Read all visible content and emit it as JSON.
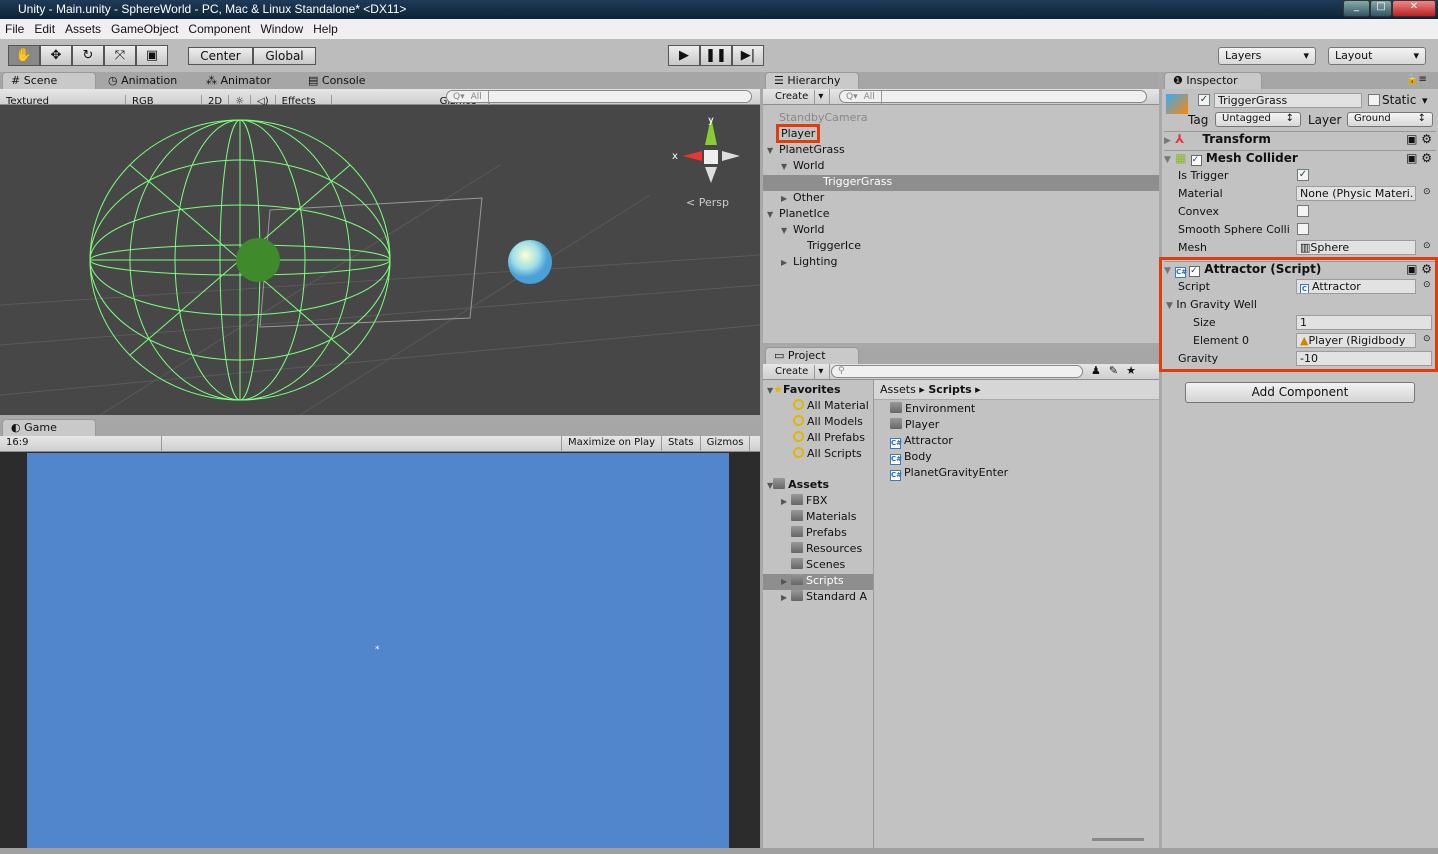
{
  "window": {
    "title": "Unity - Main.unity - SphereWorld - PC, Mac & Linux Standalone* <DX11>"
  },
  "menu": [
    "File",
    "Edit",
    "Assets",
    "GameObject",
    "Component",
    "Window",
    "Help"
  ],
  "toolbar": {
    "pivot": "Center",
    "space": "Global",
    "layers": "Layers",
    "layout": "Layout"
  },
  "scene": {
    "tabs": [
      "Scene",
      "Animation",
      "Animator",
      "Console"
    ],
    "shading": "Textured",
    "channel": "RGB",
    "mode2d": "2D",
    "effects": "Effects",
    "gizmos": "Gizmos",
    "search_placeholder": "All",
    "persp": "Persp",
    "axis_x": "x",
    "axis_y": "y"
  },
  "game": {
    "tab": "Game",
    "aspect": "16:9",
    "maximize": "Maximize on Play",
    "stats": "Stats",
    "gizmos": "Gizmos",
    "bg_color": "#5185cc"
  },
  "hierarchy": {
    "tab": "Hierarchy",
    "create": "Create",
    "search_placeholder": "All",
    "items": [
      {
        "label": "StandbyCamera",
        "indent": 0,
        "arrow": ""
      },
      {
        "label": "Player",
        "indent": 0,
        "arrow": "",
        "highlighted": true
      },
      {
        "label": "PlanetGrass",
        "indent": 0,
        "arrow": "down"
      },
      {
        "label": "World",
        "indent": 1,
        "arrow": "down"
      },
      {
        "label": "TriggerGrass",
        "indent": 2,
        "arrow": "",
        "selected": true
      },
      {
        "label": "Other",
        "indent": 1,
        "arrow": "right"
      },
      {
        "label": "PlanetIce",
        "indent": 0,
        "arrow": "down"
      },
      {
        "label": "World",
        "indent": 1,
        "arrow": "down"
      },
      {
        "label": "TriggerIce",
        "indent": 2,
        "arrow": ""
      },
      {
        "label": "Lighting",
        "indent": 1,
        "arrow": "right"
      }
    ]
  },
  "project": {
    "tab": "Project",
    "create": "Create",
    "favorites": {
      "label": "Favorites",
      "items": [
        "All Material",
        "All Models",
        "All Prefabs",
        "All Scripts"
      ]
    },
    "assets": {
      "label": "Assets",
      "items": [
        {
          "label": "FBX",
          "arrow": true
        },
        {
          "label": "Materials"
        },
        {
          "label": "Prefabs"
        },
        {
          "label": "Resources"
        },
        {
          "label": "Scenes"
        },
        {
          "label": "Scripts",
          "arrow": true,
          "selected": true
        },
        {
          "label": "Standard A",
          "arrow": true
        }
      ]
    },
    "breadcrumb": [
      "Assets",
      "Scripts"
    ],
    "files": [
      {
        "label": "Environment",
        "type": "folder"
      },
      {
        "label": "Player",
        "type": "folder"
      },
      {
        "label": "Attractor",
        "type": "script"
      },
      {
        "label": "Body",
        "type": "script"
      },
      {
        "label": "PlanetGravityEnter",
        "type": "script"
      }
    ]
  },
  "inspector": {
    "tab": "Inspector",
    "object_name": "TriggerGrass",
    "static": "Static",
    "tag_label": "Tag",
    "tag": "Untagged",
    "layer_label": "Layer",
    "layer": "Ground",
    "transform": "Transform",
    "mesh_collider": {
      "title": "Mesh Collider",
      "is_trigger": "Is Trigger",
      "material": "Material",
      "material_value": "None (Physic Materi.",
      "convex": "Convex",
      "smooth": "Smooth Sphere Colli",
      "mesh": "Mesh",
      "mesh_value": "Sphere"
    },
    "attractor": {
      "title": "Attractor (Script)",
      "script": "Script",
      "script_value": "Attractor",
      "well": "In Gravity Well",
      "size": "Size",
      "size_value": "1",
      "element0": "Element 0",
      "element0_value": "Player (Rigidbody",
      "gravity": "Gravity",
      "gravity_value": "-10"
    },
    "add_component": "Add Component"
  },
  "colors": {
    "highlight": "#e03c0c",
    "wireframe": "#7dff7d"
  }
}
